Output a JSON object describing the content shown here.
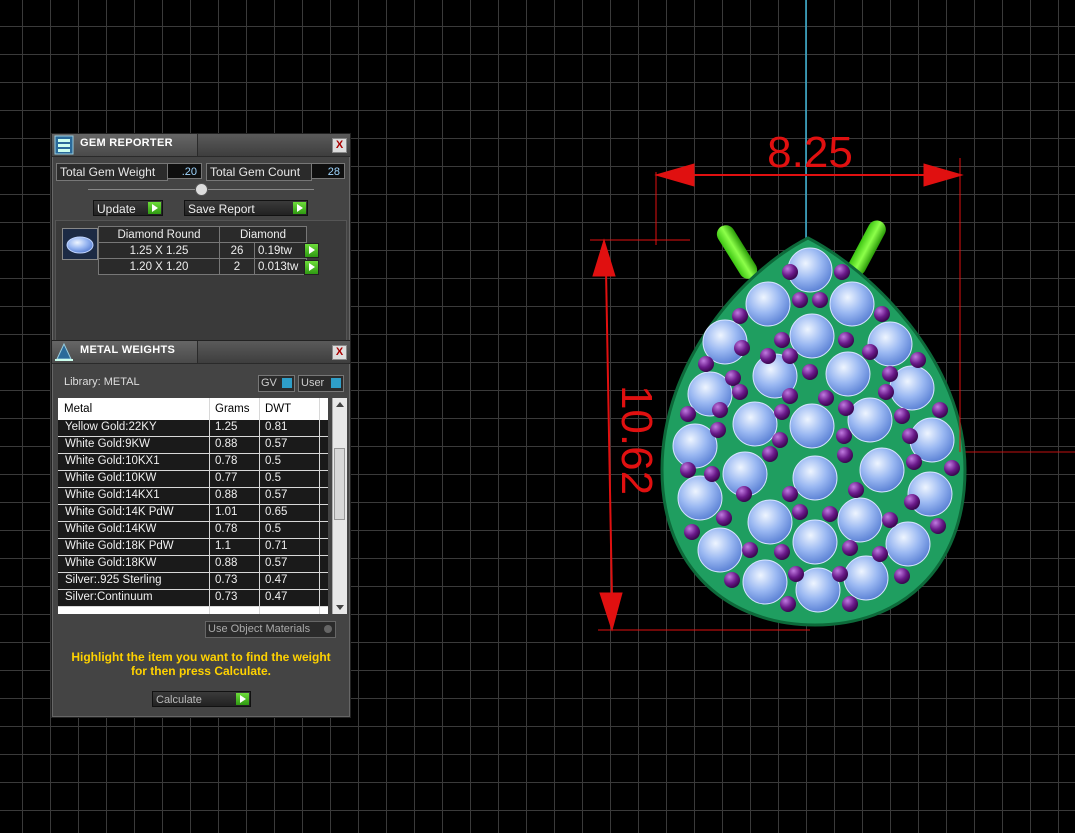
{
  "gem_reporter": {
    "title": "GEM REPORTER",
    "close": "X",
    "total_weight_label": "Total Gem Weight",
    "total_weight_value": ".20",
    "total_count_label": "Total Gem Count",
    "total_count_value": "28",
    "update_label": "Update",
    "save_report_label": "Save Report",
    "table_header_shape": "Diamond Round",
    "table_header_type": "Diamond",
    "rows": [
      {
        "size": "1.25 X 1.25",
        "count": "26",
        "weight": "0.19tw"
      },
      {
        "size": "1.20 X 1.20",
        "count": "2",
        "weight": "0.013tw"
      }
    ]
  },
  "metal_weights": {
    "title": "METAL WEIGHTS",
    "close": "X",
    "library_label": "Library: METAL",
    "gv_label": "GV",
    "user_label": "User",
    "columns": [
      "Metal",
      "Grams",
      "DWT"
    ],
    "rows": [
      [
        "Yellow Gold:22KY",
        "1.25",
        "0.81"
      ],
      [
        "White Gold:9KW",
        "0.88",
        "0.57"
      ],
      [
        "White Gold:10KX1",
        "0.78",
        "0.5"
      ],
      [
        "White Gold:10KW",
        "0.77",
        "0.5"
      ],
      [
        "White Gold:14KX1",
        "0.88",
        "0.57"
      ],
      [
        "White Gold:14K PdW",
        "1.01",
        "0.65"
      ],
      [
        "White Gold:14KW",
        "0.78",
        "0.5"
      ],
      [
        "White Gold:18K PdW",
        "1.1",
        "0.71"
      ],
      [
        "White Gold:18KW",
        "0.88",
        "0.57"
      ],
      [
        "Silver:.925 Sterling",
        "0.73",
        "0.47"
      ],
      [
        "Silver:Continuum",
        "0.73",
        "0.47"
      ]
    ],
    "use_object_materials": "Use Object Materials",
    "hint_line1": "Highlight the item you want to find the weight",
    "hint_line2": "for then press Calculate.",
    "calculate_label": "Calculate"
  },
  "viewport": {
    "width_dimension": "8.25",
    "height_dimension": "10.62"
  },
  "colors": {
    "dimension_red": "#e01010",
    "metal_green": "#1f9e60",
    "gem_blue": "#8fb4f0",
    "accent_gem_purple": "#6a1a8a",
    "hint_yellow": "#ffd200"
  }
}
